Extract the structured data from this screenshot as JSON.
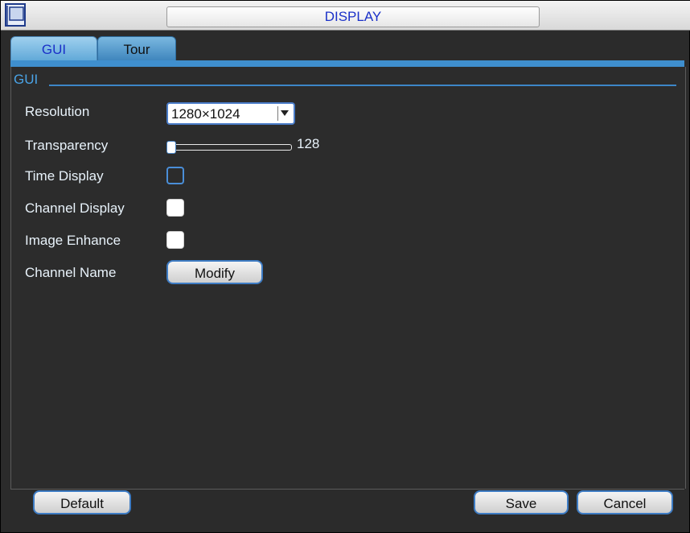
{
  "window": {
    "title": "DISPLAY"
  },
  "tabs": [
    {
      "label": "GUI",
      "active": true
    },
    {
      "label": "Tour",
      "active": false
    }
  ],
  "section": {
    "label": "GUI"
  },
  "fields": {
    "resolution": {
      "label": "Resolution",
      "value": "1280×1024"
    },
    "transparency": {
      "label": "Transparency",
      "value": "128",
      "level": 0
    },
    "time_display": {
      "label": "Time Display",
      "checked": false
    },
    "channel_display": {
      "label": "Channel Display",
      "checked": true
    },
    "image_enhance": {
      "label": "Image Enhance",
      "checked": true
    },
    "channel_name": {
      "label": "Channel Name",
      "button": "Modify"
    }
  },
  "footer": {
    "default_label": "Default",
    "save_label": "Save",
    "cancel_label": "Cancel"
  },
  "colors": {
    "title_text": "#1a30c8",
    "accent": "#3d86c8",
    "panel_bg": "#2c2c2c"
  }
}
